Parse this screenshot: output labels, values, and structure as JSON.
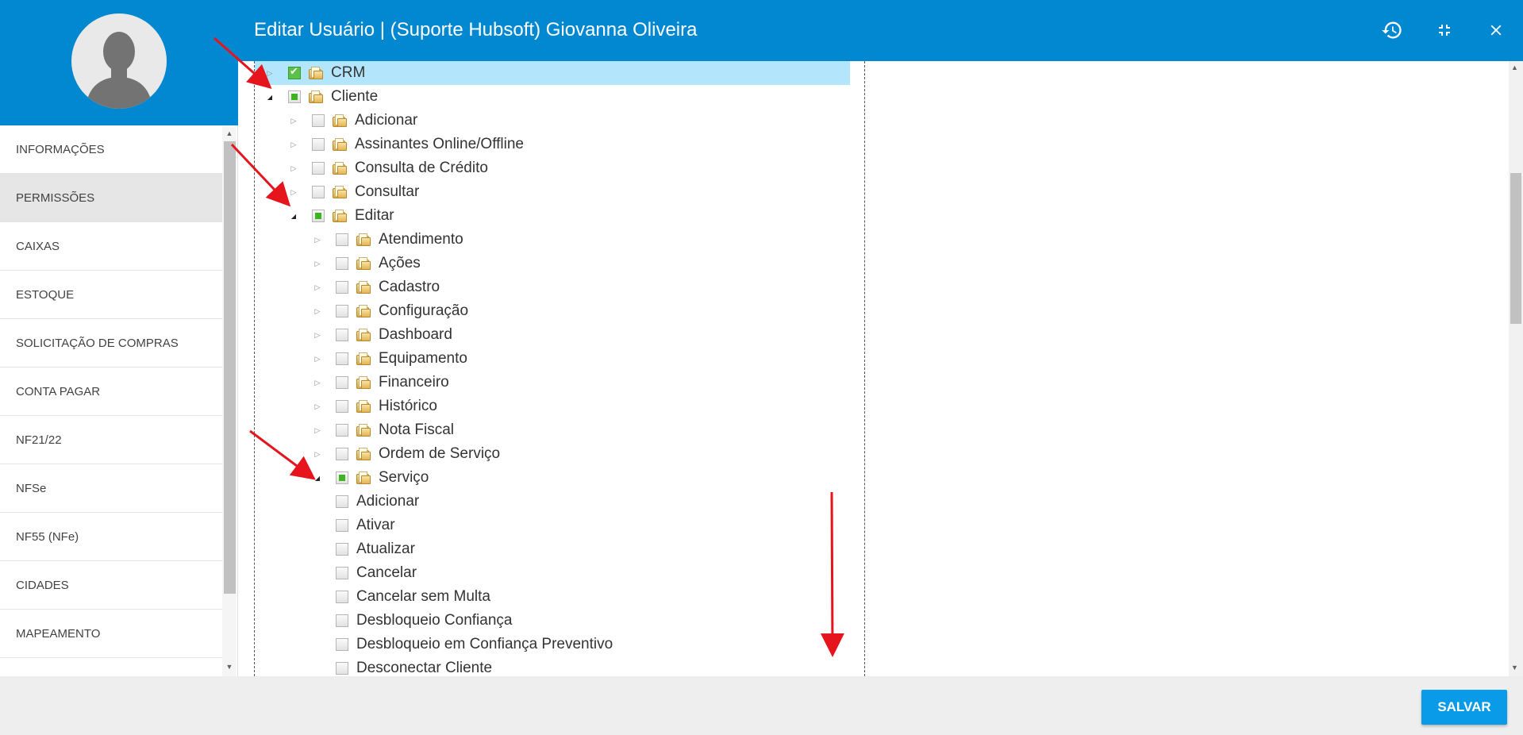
{
  "header": {
    "title": "Editar Usuário | (Suporte Hubsoft) Giovanna Oliveira",
    "icons": [
      "history-icon",
      "collapse-icon",
      "close-icon"
    ]
  },
  "sidebar": {
    "avatar_icon": "user-avatar-icon",
    "items": [
      {
        "label": "INFORMAÇÕES",
        "active": false
      },
      {
        "label": "PERMISSÕES",
        "active": true
      },
      {
        "label": "CAIXAS",
        "active": false
      },
      {
        "label": "ESTOQUE",
        "active": false
      },
      {
        "label": "SOLICITAÇÃO DE COMPRAS",
        "active": false
      },
      {
        "label": "CONTA PAGAR",
        "active": false
      },
      {
        "label": "NF21/22",
        "active": false
      },
      {
        "label": "NFSe",
        "active": false
      },
      {
        "label": "NF55 (NFe)",
        "active": false
      },
      {
        "label": "CIDADES",
        "active": false
      },
      {
        "label": "MAPEAMENTO",
        "active": false
      }
    ]
  },
  "tree": {
    "nodes": [
      {
        "label": "CRM",
        "level": 0,
        "state": "checked",
        "expanded": false,
        "folder": true,
        "selected": true
      },
      {
        "label": "Cliente",
        "level": 0,
        "state": "partial",
        "expanded": true,
        "folder": true
      },
      {
        "label": "Adicionar",
        "level": 1,
        "state": "unchecked",
        "expanded": false,
        "folder": true
      },
      {
        "label": "Assinantes Online/Offline",
        "level": 1,
        "state": "unchecked",
        "expanded": false,
        "folder": true
      },
      {
        "label": "Consulta de Crédito",
        "level": 1,
        "state": "unchecked",
        "expanded": false,
        "folder": true
      },
      {
        "label": "Consultar",
        "level": 1,
        "state": "unchecked",
        "expanded": false,
        "folder": true
      },
      {
        "label": "Editar",
        "level": 1,
        "state": "partial",
        "expanded": true,
        "folder": true
      },
      {
        "label": "Atendimento",
        "level": 2,
        "state": "unchecked",
        "expanded": false,
        "folder": true
      },
      {
        "label": "Ações",
        "level": 2,
        "state": "unchecked",
        "expanded": false,
        "folder": true
      },
      {
        "label": "Cadastro",
        "level": 2,
        "state": "unchecked",
        "expanded": false,
        "folder": true
      },
      {
        "label": "Configuração",
        "level": 2,
        "state": "unchecked",
        "expanded": false,
        "folder": true
      },
      {
        "label": "Dashboard",
        "level": 2,
        "state": "unchecked",
        "expanded": false,
        "folder": true
      },
      {
        "label": "Equipamento",
        "level": 2,
        "state": "unchecked",
        "expanded": false,
        "folder": true
      },
      {
        "label": "Financeiro",
        "level": 2,
        "state": "unchecked",
        "expanded": false,
        "folder": true
      },
      {
        "label": "Histórico",
        "level": 2,
        "state": "unchecked",
        "expanded": false,
        "folder": true
      },
      {
        "label": "Nota Fiscal",
        "level": 2,
        "state": "unchecked",
        "expanded": false,
        "folder": true
      },
      {
        "label": "Ordem de Serviço",
        "level": 2,
        "state": "unchecked",
        "expanded": false,
        "folder": true
      },
      {
        "label": "Serviço",
        "level": 2,
        "state": "partial",
        "expanded": true,
        "folder": true
      },
      {
        "label": "Adicionar",
        "level": 3,
        "state": "unchecked",
        "leaf": true,
        "folder": false
      },
      {
        "label": "Ativar",
        "level": 3,
        "state": "unchecked",
        "leaf": true,
        "folder": false
      },
      {
        "label": "Atualizar",
        "level": 3,
        "state": "unchecked",
        "leaf": true,
        "folder": false
      },
      {
        "label": "Cancelar",
        "level": 3,
        "state": "unchecked",
        "leaf": true,
        "folder": false
      },
      {
        "label": "Cancelar sem Multa",
        "level": 3,
        "state": "unchecked",
        "leaf": true,
        "folder": false
      },
      {
        "label": "Desbloqueio Confiança",
        "level": 3,
        "state": "unchecked",
        "leaf": true,
        "folder": false
      },
      {
        "label": "Desbloqueio em Confiança Preventivo",
        "level": 3,
        "state": "unchecked",
        "leaf": true,
        "folder": false
      },
      {
        "label": "Desconectar Cliente",
        "level": 3,
        "state": "unchecked",
        "leaf": true,
        "folder": false
      }
    ]
  },
  "footer": {
    "save_label": "SALVAR"
  },
  "colors": {
    "header_bg": "#0288d1",
    "save_bg": "#0a9be8",
    "annotation_arrow": "#e5141d",
    "checkbox_green": "#3cb521"
  }
}
